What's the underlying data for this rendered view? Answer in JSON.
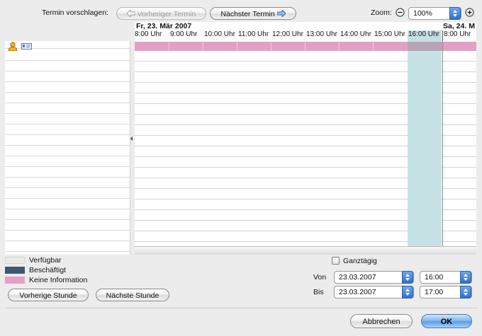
{
  "toolbar": {
    "suggest_label": "Termin vorschlagen:",
    "prev_appointment": "Vorheriger Termin",
    "next_appointment": "Nächster Termin",
    "zoom_label": "Zoom:",
    "zoom_value": "100%"
  },
  "grid": {
    "day1": "Fr, 23. Mär 2007",
    "day2": "Sa, 24. M",
    "hours": [
      "8:00 Uhr",
      "9:00 Uhr",
      "10:00 Uhr",
      "11:00 Uhr",
      "12:00 Uhr",
      "13:00 Uhr",
      "14:00 Uhr",
      "15:00 Uhr",
      "16:00 Uhr",
      "8:00 Uhr"
    ]
  },
  "legend": {
    "free": "Verfügbar",
    "busy": "Beschäftigt",
    "no_info": "Keine Information"
  },
  "buttons": {
    "prev_hour": "Vorherige Stunde",
    "next_hour": "Nächste Stunde",
    "cancel": "Abbrechen",
    "ok": "OK"
  },
  "form": {
    "all_day_label": "Ganztägig",
    "from_label": "Von",
    "to_label": "Bis",
    "from_date": "23.03.2007",
    "from_time": "16:00",
    "to_date": "23.03.2007",
    "to_time": "17:00"
  },
  "colors": {
    "free": "#ebebe6",
    "busy": "#3f5672",
    "no_info": "#e2a0c4",
    "selection": "#c4e0e4"
  }
}
